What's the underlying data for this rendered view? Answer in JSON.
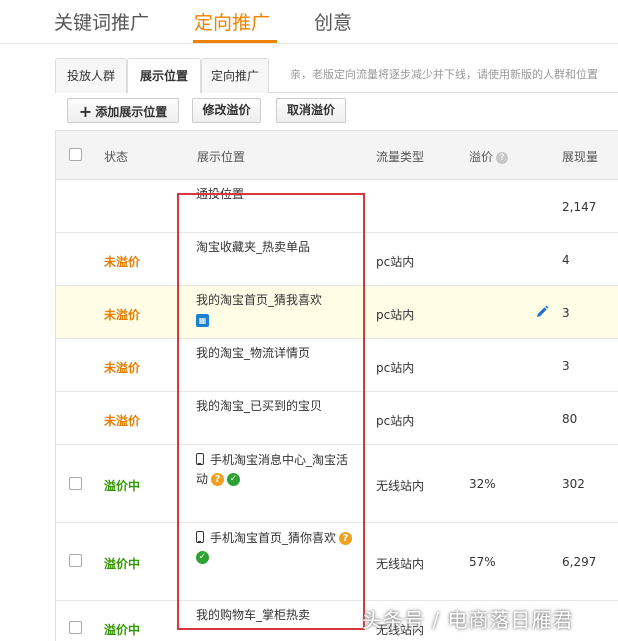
{
  "top_tabs": [
    {
      "label": "关键词推广"
    },
    {
      "label": "定向推广"
    },
    {
      "label": "创意"
    }
  ],
  "sub_tabs": [
    {
      "label": "投放人群"
    },
    {
      "label": "展示位置"
    },
    {
      "label": "定向推广"
    }
  ],
  "notice": "亲，老版定向流量将逐步减少并下线，请使用新版的人群和位置",
  "toolbar": {
    "add_label": "添加展示位置",
    "edit_label": "修改溢价",
    "cancel_label": "取消溢价"
  },
  "columns": {
    "status": "状态",
    "position": "展示位置",
    "traffic": "流量类型",
    "premium": "溢价",
    "impressions": "展现量"
  },
  "rows": [
    {
      "status": "",
      "position": "通投位置",
      "traffic": "",
      "premium": "",
      "impressions": "2,147"
    },
    {
      "status": "未溢价",
      "position": "淘宝收藏夹_热卖单品",
      "traffic": "pc站内",
      "premium": "",
      "impressions": "4"
    },
    {
      "status": "未溢价",
      "position": "我的淘宝首页_猜我喜欢",
      "traffic": "pc站内",
      "premium": "",
      "impressions": "3"
    },
    {
      "status": "未溢价",
      "position": "我的淘宝_物流详情页",
      "traffic": "pc站内",
      "premium": "",
      "impressions": "3"
    },
    {
      "status": "未溢价",
      "position": "我的淘宝_已买到的宝贝",
      "traffic": "pc站内",
      "premium": "",
      "impressions": "80"
    },
    {
      "status": "溢价中",
      "position": "手机淘宝消息中心_淘宝活",
      "position_line2": "动",
      "traffic": "无线站内",
      "premium": "32%",
      "impressions": "302"
    },
    {
      "status": "溢价中",
      "position": "手机淘宝首页_猜你喜欢",
      "traffic": "无线站内",
      "premium": "57%",
      "impressions": "6,297"
    },
    {
      "status": "溢价中",
      "position": "我的购物车_掌柜热卖",
      "traffic": "无线站内",
      "premium": "",
      "impressions": ""
    }
  ],
  "icons": {
    "help": "?",
    "check": "✓"
  },
  "watermark": "头条号 / 电商落日雁君",
  "colors": {
    "accent_orange": "#f08200",
    "status_unpremium": "#e67e00",
    "status_premium": "#339900",
    "highlight_box": "#d9363e",
    "row_highlight": "#fffde6"
  }
}
